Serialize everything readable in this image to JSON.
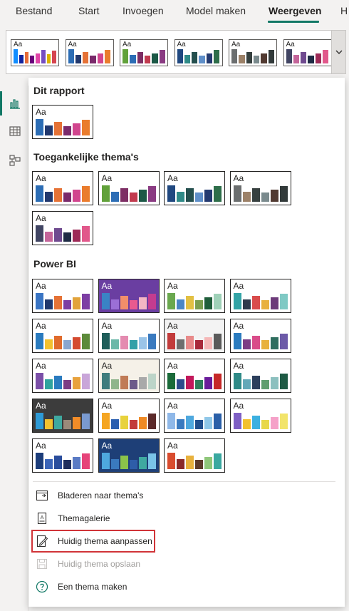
{
  "tabs": [
    {
      "label": "Bestand",
      "active": false
    },
    {
      "label": "Start",
      "active": false
    },
    {
      "label": "Invoegen",
      "active": false
    },
    {
      "label": "Model maken",
      "active": false
    },
    {
      "label": "Weergeven",
      "active": true
    },
    {
      "label": "H",
      "active": false
    }
  ],
  "theme_icon_text": "Aa",
  "ribbon_thumbs": [
    {
      "bg": "#ffffff",
      "colors": [
        "#118dff",
        "#12239e",
        "#e66c37",
        "#6b007b",
        "#e044a7",
        "#744ec2",
        "#d9b300",
        "#d64550"
      ]
    },
    {
      "bg": "#ffffff",
      "colors": [
        "#2c6db5",
        "#21386e",
        "#e57236",
        "#7a2a6b",
        "#d1458e",
        "#ea7c2d"
      ]
    },
    {
      "bg": "#ffffff",
      "colors": [
        "#61a13a",
        "#2c6db5",
        "#7d2e64",
        "#c13b4f",
        "#1c5947",
        "#8a3b82"
      ]
    },
    {
      "bg": "#ffffff",
      "colors": [
        "#204880",
        "#2f8a87",
        "#244f4e",
        "#5f8fc9",
        "#243a70",
        "#2e6e4a"
      ]
    },
    {
      "bg": "#ffffff",
      "colors": [
        "#6b6e6f",
        "#9c8168",
        "#36403f",
        "#7a8a8d",
        "#513a31",
        "#323a3a"
      ]
    },
    {
      "bg": "#ffffff",
      "colors": [
        "#414563",
        "#c4659a",
        "#6f4a8f",
        "#1e2b44",
        "#9d2a57",
        "#e1588b"
      ]
    }
  ],
  "sections": [
    {
      "title": "Dit rapport",
      "themes": [
        {
          "bg": "#ffffff",
          "colors": [
            "#2c6db5",
            "#21386e",
            "#e57236",
            "#7a2a6b",
            "#d1458e",
            "#ea7c2d"
          ]
        }
      ]
    },
    {
      "title": "Toegankelijke thema's",
      "themes": [
        {
          "bg": "#ffffff",
          "colors": [
            "#2c6db5",
            "#21386e",
            "#e57236",
            "#7a2a6b",
            "#d1458e",
            "#ea7c2d"
          ]
        },
        {
          "bg": "#ffffff",
          "colors": [
            "#61a13a",
            "#2c6db5",
            "#7d2e64",
            "#c13b4f",
            "#1c5947",
            "#8a3b82"
          ]
        },
        {
          "bg": "#ffffff",
          "colors": [
            "#204880",
            "#2f8a87",
            "#244f4e",
            "#5f8fc9",
            "#243a70",
            "#2e6e4a"
          ]
        },
        {
          "bg": "#ffffff",
          "colors": [
            "#6b6e6f",
            "#9c8168",
            "#36403f",
            "#7a8a8d",
            "#513a31",
            "#323a3a"
          ]
        },
        {
          "bg": "#ffffff",
          "colors": [
            "#414563",
            "#c4659a",
            "#6f4a8f",
            "#1e2b44",
            "#9d2a57",
            "#e1588b"
          ]
        }
      ]
    },
    {
      "title": "Power BI",
      "themes": [
        {
          "bg": "#ffffff",
          "colors": [
            "#3a75c4",
            "#21386e",
            "#e57236",
            "#7d3ea3",
            "#e2a33b",
            "#7d3ea3"
          ]
        },
        {
          "bg": "#6a3ea1",
          "text": "#ffffff",
          "colors": [
            "#3a83c5",
            "#9b6fd6",
            "#f28e6a",
            "#e95a8f",
            "#f4b6c4",
            "#c43c8f"
          ]
        },
        {
          "bg": "#ffffff",
          "colors": [
            "#6aa84f",
            "#4a86c5",
            "#e2c043",
            "#7a9e4f",
            "#1f5e3a",
            "#9fd1b8"
          ]
        },
        {
          "bg": "#ffffff",
          "colors": [
            "#33a4a6",
            "#2f3a4c",
            "#d94c4c",
            "#e8b13d",
            "#6d3b7a",
            "#7fc9c4"
          ]
        },
        {
          "bg": "#ffffff",
          "colors": [
            "#2a7bbf",
            "#f2c12e",
            "#e06b2c",
            "#8aa6cf",
            "#d44a2f",
            "#5c8a3a"
          ]
        },
        {
          "bg": "#ffffff",
          "colors": [
            "#1f5e5a",
            "#6bb8a8",
            "#e48bb0",
            "#33a0a8",
            "#9ac4e8",
            "#3a7abf"
          ]
        },
        {
          "bg": "#f3f3f3",
          "colors": [
            "#c23b3b",
            "#6e6e6e",
            "#e88a8a",
            "#a82a3a",
            "#f5b7b7",
            "#5a5a5a"
          ]
        },
        {
          "bg": "#ffffff",
          "colors": [
            "#2a7bbf",
            "#7c3c85",
            "#d94c8a",
            "#e8b13d",
            "#2f6e5f",
            "#6c5aa8"
          ]
        },
        {
          "bg": "#ffffff",
          "colors": [
            "#7b4fa8",
            "#2fa39e",
            "#2a7bbf",
            "#7c3c85",
            "#e8a23d",
            "#c9a6d9"
          ]
        },
        {
          "bg": "#f5f1e8",
          "colors": [
            "#3f7c7d",
            "#8fb58c",
            "#c07b56",
            "#6d5b8a",
            "#a9a9a9",
            "#bcd4c8"
          ]
        },
        {
          "bg": "#ffffff",
          "colors": [
            "#1b6b3a",
            "#2d4a8c",
            "#c2185b",
            "#2e7d5a",
            "#6a1b9a",
            "#c62828"
          ]
        },
        {
          "bg": "#ffffff",
          "colors": [
            "#2f8a87",
            "#63a8b8",
            "#2d3f5c",
            "#5f9e6e",
            "#8cc0bf",
            "#1e5a44"
          ]
        },
        {
          "bg": "#3c3c3c",
          "text": "#ffffff",
          "colors": [
            "#2d9ad6",
            "#f2c12e",
            "#3fa9a0",
            "#9b8a7a",
            "#f28c28",
            "#7a9ad0"
          ]
        },
        {
          "bg": "#ffffff",
          "colors": [
            "#f5a623",
            "#2a5fb0",
            "#e8d23c",
            "#c23b3b",
            "#f08a24",
            "#5c2a2a"
          ]
        },
        {
          "bg": "#ffffff",
          "colors": [
            "#8fb8e8",
            "#3a7abf",
            "#4ea8de",
            "#1f4e8c",
            "#8fc7e8",
            "#2a5fa8"
          ]
        },
        {
          "bg": "#ffffff",
          "colors": [
            "#7e5fc4",
            "#f2c12e",
            "#3cb0e0",
            "#e8d84a",
            "#f5a1c8",
            "#f2e46a"
          ]
        },
        {
          "bg": "#ffffff",
          "colors": [
            "#1c3d7a",
            "#3a64b8",
            "#2a4d9c",
            "#1f2d5c",
            "#5a7ac4",
            "#e6447a"
          ]
        },
        {
          "bg": "#1e3f77",
          "text": "#ffffff",
          "colors": [
            "#4ea8de",
            "#3a7abf",
            "#8bc34a",
            "#2e5da8",
            "#3fa9a0",
            "#7ac4e8"
          ]
        },
        {
          "bg": "#ffffff",
          "colors": [
            "#d94c2f",
            "#8a2a2a",
            "#e8b13d",
            "#5c3a2a",
            "#8fc77a",
            "#3aa8a0"
          ]
        }
      ]
    }
  ],
  "actions": [
    {
      "label": "Bladeren naar thema's",
      "icon": "browse-themes-icon",
      "enabled": true,
      "highlighted": false
    },
    {
      "label": "Themagalerie",
      "icon": "theme-gallery-icon",
      "enabled": true,
      "highlighted": false
    },
    {
      "label": "Huidig thema aanpassen",
      "icon": "customize-theme-icon",
      "enabled": true,
      "highlighted": true
    },
    {
      "label": "Huidig thema opslaan",
      "icon": "save-theme-icon",
      "enabled": false,
      "highlighted": false
    },
    {
      "label": "Een thema maken",
      "icon": "help-create-theme-icon",
      "enabled": true,
      "highlighted": false
    }
  ],
  "colors": {
    "accent": "#117865",
    "highlight_border": "#d13438"
  }
}
